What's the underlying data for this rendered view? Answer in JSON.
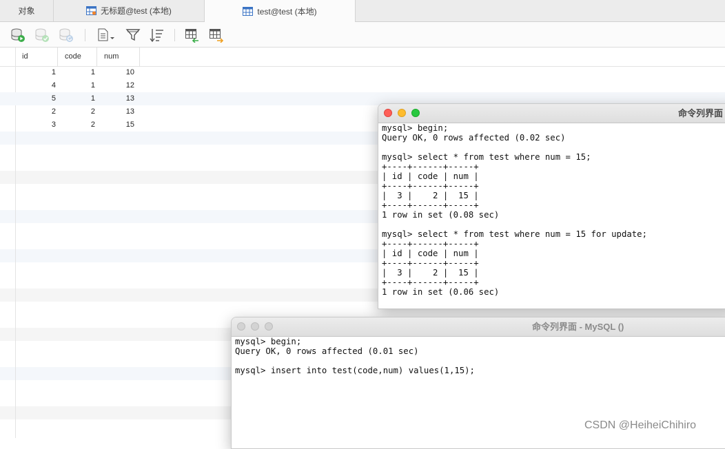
{
  "tabs": [
    {
      "label": "对象",
      "icon": "none"
    },
    {
      "label": "无标题@test (本地)",
      "icon": "query-icon"
    },
    {
      "label": "test@test (本地)",
      "icon": "table-icon"
    }
  ],
  "toolbar": {
    "icons": [
      "db-run-icon",
      "db-commit-icon",
      "db-rollback-icon",
      "text-view-icon",
      "filter-icon",
      "sort-icon",
      "import-icon",
      "export-icon"
    ]
  },
  "table": {
    "columns": [
      "id",
      "code",
      "num"
    ],
    "rows": [
      [
        "1",
        "1",
        "10"
      ],
      [
        "4",
        "1",
        "12"
      ],
      [
        "5",
        "1",
        "13"
      ],
      [
        "2",
        "2",
        "13"
      ],
      [
        "3",
        "2",
        "15"
      ]
    ]
  },
  "terminal1": {
    "title": "命令列界面",
    "lines": [
      "mysql> begin;",
      "Query OK, 0 rows affected (0.02 sec)",
      "",
      "mysql> select * from test where num = 15;",
      "+----+------+-----+",
      "| id | code | num |",
      "+----+------+-----+",
      "|  3 |    2 |  15 |",
      "+----+------+-----+",
      "1 row in set (0.08 sec)",
      "",
      "mysql> select * from test where num = 15 for update;",
      "+----+------+-----+",
      "| id | code | num |",
      "+----+------+-----+",
      "|  3 |    2 |  15 |",
      "+----+------+-----+",
      "1 row in set (0.06 sec)"
    ]
  },
  "terminal2": {
    "title": "命令列界面 - MySQL ()",
    "lines": [
      "mysql> begin;",
      "Query OK, 0 rows affected (0.01 sec)",
      "",
      "mysql> insert into test(code,num) values(1,15);"
    ]
  },
  "watermark": "CSDN @HeiheiChihiro",
  "colors": {
    "close": "#fe5f57",
    "minimize": "#febc2e",
    "zoom": "#28c840",
    "inactive_light": "#d3d3d3"
  }
}
